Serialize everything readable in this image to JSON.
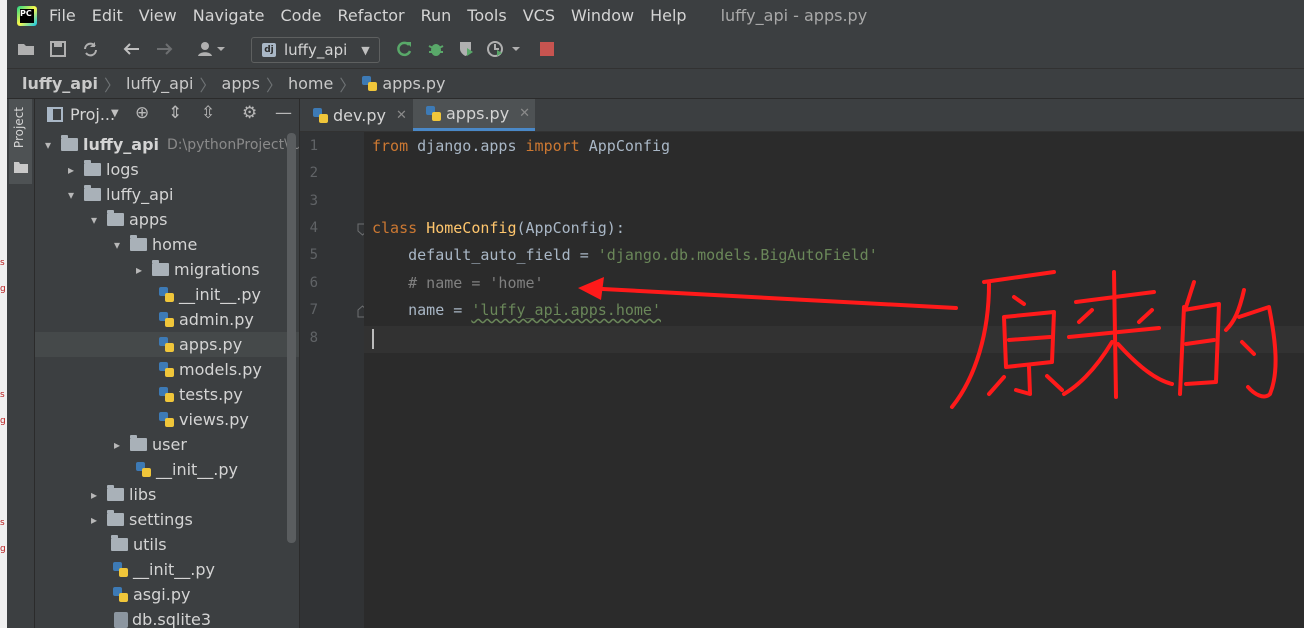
{
  "menu": {
    "items": [
      "File",
      "Edit",
      "View",
      "Navigate",
      "Code",
      "Refactor",
      "Run",
      "Tools",
      "VCS",
      "Window",
      "Help"
    ],
    "window_title": "luffy_api - apps.py",
    "logo_text": "PC"
  },
  "toolbar": {
    "run_config": "luffy_api",
    "run_config_icon": "dj"
  },
  "breadcrumb": [
    "luffy_api",
    "luffy_api",
    "apps",
    "home",
    "apps.py"
  ],
  "sidebar": {
    "project_tab": "Project"
  },
  "project_panel": {
    "title": "Proj...",
    "root_path": "D:\\pythonProject\\lu",
    "tree": [
      {
        "label": "luffy_api",
        "type": "folder",
        "expanded": true,
        "bold": true
      },
      {
        "label": "logs",
        "type": "folder",
        "expanded": false
      },
      {
        "label": "luffy_api",
        "type": "folder",
        "expanded": true
      },
      {
        "label": "apps",
        "type": "folder",
        "expanded": true
      },
      {
        "label": "home",
        "type": "folder",
        "expanded": true
      },
      {
        "label": "migrations",
        "type": "folder",
        "expanded": false
      },
      {
        "label": "__init__.py",
        "type": "py"
      },
      {
        "label": "admin.py",
        "type": "py"
      },
      {
        "label": "apps.py",
        "type": "py",
        "selected": true
      },
      {
        "label": "models.py",
        "type": "py"
      },
      {
        "label": "tests.py",
        "type": "py"
      },
      {
        "label": "views.py",
        "type": "py"
      },
      {
        "label": "user",
        "type": "folder",
        "expanded": false
      },
      {
        "label": "__init__.py",
        "type": "py"
      },
      {
        "label": "libs",
        "type": "folder",
        "expanded": false
      },
      {
        "label": "settings",
        "type": "folder",
        "expanded": false
      },
      {
        "label": "utils",
        "type": "folder"
      },
      {
        "label": "__init__.py",
        "type": "py"
      },
      {
        "label": "asgi.py",
        "type": "py"
      },
      {
        "label": "db.sqlite3",
        "type": "db"
      }
    ]
  },
  "editor": {
    "tabs": [
      {
        "label": "dev.py",
        "active": false
      },
      {
        "label": "apps.py",
        "active": true
      }
    ],
    "line_numbers": [
      "1",
      "2",
      "3",
      "4",
      "5",
      "6",
      "7",
      "8"
    ],
    "code": {
      "l1_from": "from",
      "l1_module": " django.apps ",
      "l1_import": "import",
      "l1_name": " AppConfig",
      "l4_class": "class",
      "l4_name": "HomeConfig",
      "l4_base": "(AppConfig):",
      "l5_lhs": "    default_auto_field = ",
      "l5_str": "'django.db.models.BigAutoField'",
      "l6_comment": "    # name = 'home'",
      "l7_lhs": "    name = ",
      "l7_str": "'luffy_api.apps.home'"
    }
  },
  "annotation": {
    "text": "原来的",
    "color": "#ff1a1a"
  },
  "colors": {
    "keyword": "#cc7832",
    "class_name": "#ffc66d",
    "string": "#6a8759",
    "comment": "#808080",
    "accent": "#4a88c7"
  }
}
